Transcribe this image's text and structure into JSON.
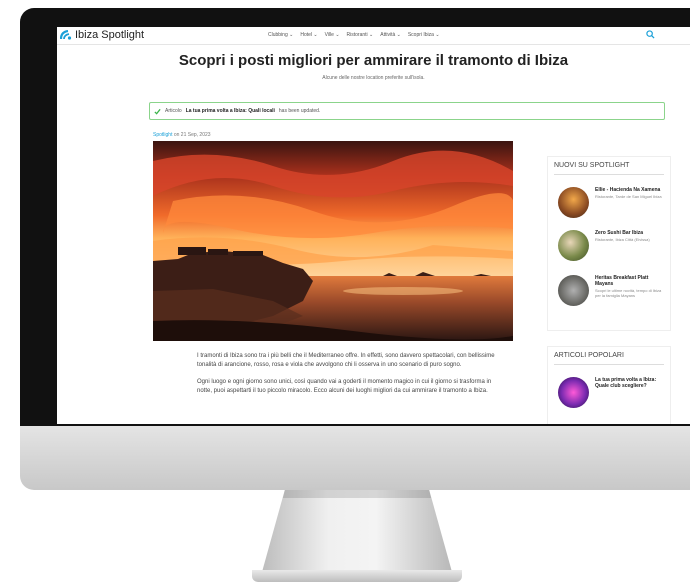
{
  "site": {
    "logo": "Ibiza Spotlight",
    "menu": [
      "Clubbing ⌄",
      "Hotel ⌄",
      "Ville ⌄",
      "Ristoranti ⌄",
      "Attività ⌄",
      "Scopri Ibiza ⌄"
    ]
  },
  "page": {
    "title": "Scopri i posti migliori per ammirare il tramonto di Ibiza",
    "subtitle": "Alcune delle nostre location preferite sull'isola."
  },
  "notice": {
    "prefix": "Articolo",
    "bold": "La tua prima volta a Ibiza: Quali locali",
    "suffix": "has been updated."
  },
  "byline": {
    "author": "Spotlight",
    "date": "on 21 Sep, 2023"
  },
  "article": {
    "p1": "I tramonti di Ibiza sono tra i più belli che il Mediterraneo offre. In effetti, sono davvero spettacolari, con bellissime tonalità di arancione, rosso, rosa e viola che avvolgono chi li osserva in uno scenario di puro sogno.",
    "p2": "Ogni luogo e ogni giorno sono unici, così quando vai a goderti il momento magico in cui il giorno si trasforma in notte, puoi aspettarti il tuo piccolo miracolo. Ecco alcuni dei luoghi migliori da cui ammirare il tramonto a Ibiza."
  },
  "sidebar": {
    "new_title": "Nuovi su Spotlight",
    "new_items": [
      {
        "name": "Ellie - Hacienda Na Xamena",
        "meta": "Ristorante, Tarde de San Miguel Ibiza"
      },
      {
        "name": "Zero Sushi Bar Ibiza",
        "meta": "Ristorante, Ibiza Città (Eivissa)"
      },
      {
        "name": "Heritas Breakfast Platt Mayans",
        "meta": "Scopri le ultime novità, tempo di Ibiza per la famiglia Mayans"
      }
    ],
    "popular_title": "Articoli popolari",
    "popular_items": [
      {
        "name": "La tua prima volta a Ibiza: Quale club scegliere?"
      }
    ]
  },
  "colors": {
    "accent": "#1aa0d8",
    "notice_border": "#8bd48b",
    "notice_check": "#3bb34a"
  },
  "icons": {
    "search": "search-icon",
    "check": "check-icon",
    "logo": "spotlight-logo-icon"
  }
}
